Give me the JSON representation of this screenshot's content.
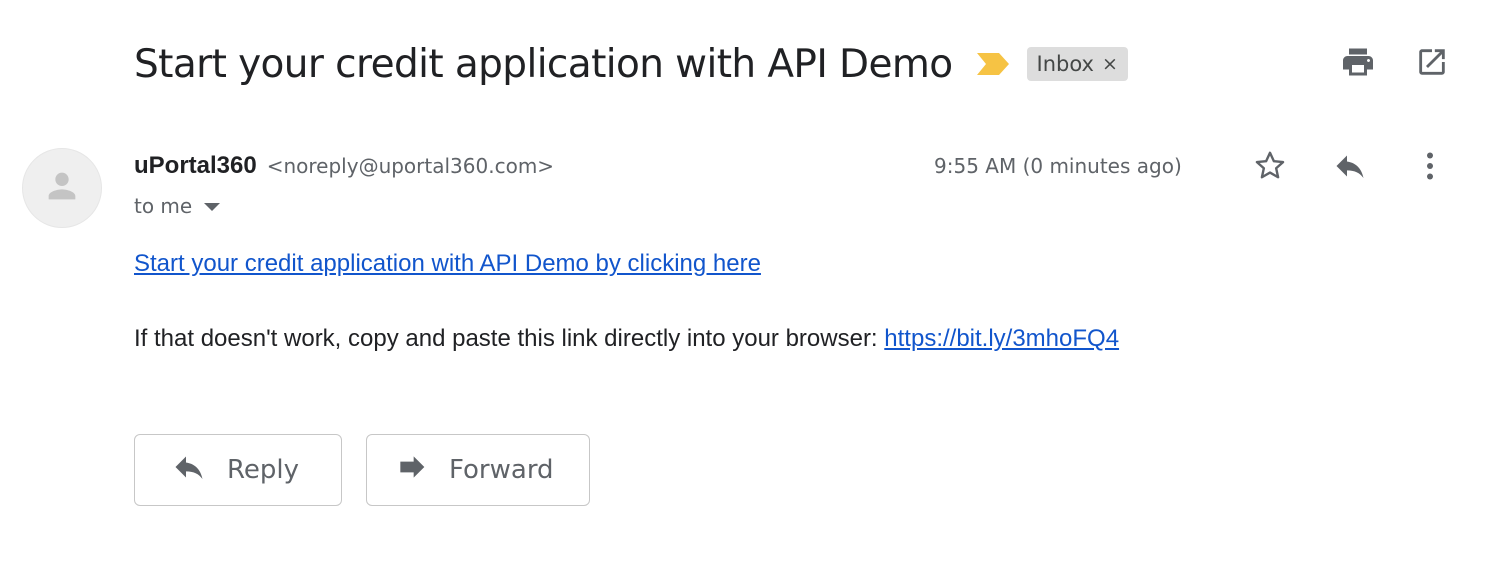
{
  "email": {
    "subject": "Start your credit application with API Demo",
    "label": "Inbox",
    "label_close": "×",
    "sender_name": "uPortal360",
    "sender_email": "<noreply@uportal360.com>",
    "recipient": "to me",
    "timestamp": "9:55 AM (0 minutes ago)",
    "body": {
      "primary_link": "Start your credit application with API Demo by clicking here",
      "fallback_text": "If that doesn't work, copy and paste this link directly into your browser: ",
      "fallback_link": "https://bit.ly/3mhoFQ4"
    }
  },
  "actions": {
    "reply_label": "Reply",
    "forward_label": "Forward"
  },
  "icons": {
    "importance": "importance-marker-icon",
    "print": "print-icon",
    "open_new_window": "open-in-new-window-icon",
    "star": "star-icon",
    "reply": "reply-icon",
    "more": "more-vertical-icon",
    "forward": "forward-icon",
    "avatar": "person-icon"
  },
  "colors": {
    "link": "#1155cc",
    "importance": "#f6c344",
    "chip_bg": "#dddddd",
    "icon": "#5f6368"
  }
}
